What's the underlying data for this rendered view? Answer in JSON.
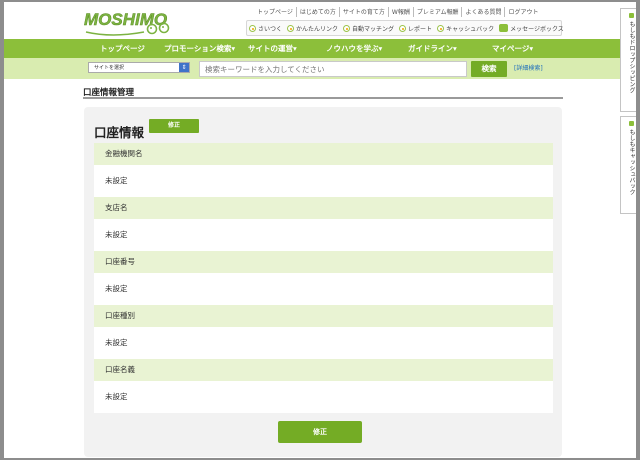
{
  "header": {
    "logo_text": "MOSHIMO",
    "top_links": [
      "トップページ",
      "はじめての方",
      "サイトの育て方",
      "W報酬",
      "プレミアム報酬",
      "よくある質問",
      "ログアウト"
    ],
    "sub_links": [
      "さいつく",
      "かんたんリンク",
      "自動マッチング",
      "レポート",
      "キャッシュバック"
    ],
    "message_box": "メッセージボックス"
  },
  "main_nav": [
    "トップページ",
    "プロモーション検索▾",
    "サイトの運営▾",
    "ノウハウを学ぶ▾",
    "ガイドライン▾",
    "マイページ▾"
  ],
  "search": {
    "site_select": "サイトを選択",
    "placeholder": "検索キーワードを入力してください",
    "button": "検索",
    "advanced": "[詳細検索]"
  },
  "side_tabs": [
    "もしもドロップシッピング",
    "もしもキャッシュバック"
  ],
  "page": {
    "title": "口座情報管理",
    "heading": "口座情報",
    "edit_small": "修正",
    "edit_large": "修正",
    "fields": [
      {
        "label": "金融機関名",
        "value": "未設定"
      },
      {
        "label": "支店名",
        "value": "未設定"
      },
      {
        "label": "口座番号",
        "value": "未設定"
      },
      {
        "label": "口座種別",
        "value": "未設定"
      },
      {
        "label": "口座名義",
        "value": "未設定"
      }
    ]
  },
  "colors": {
    "accent_green": "#8cbf3a",
    "button_green": "#74ac25",
    "label_bg": "#e9f3d3",
    "logo_green": "#7cb342"
  }
}
